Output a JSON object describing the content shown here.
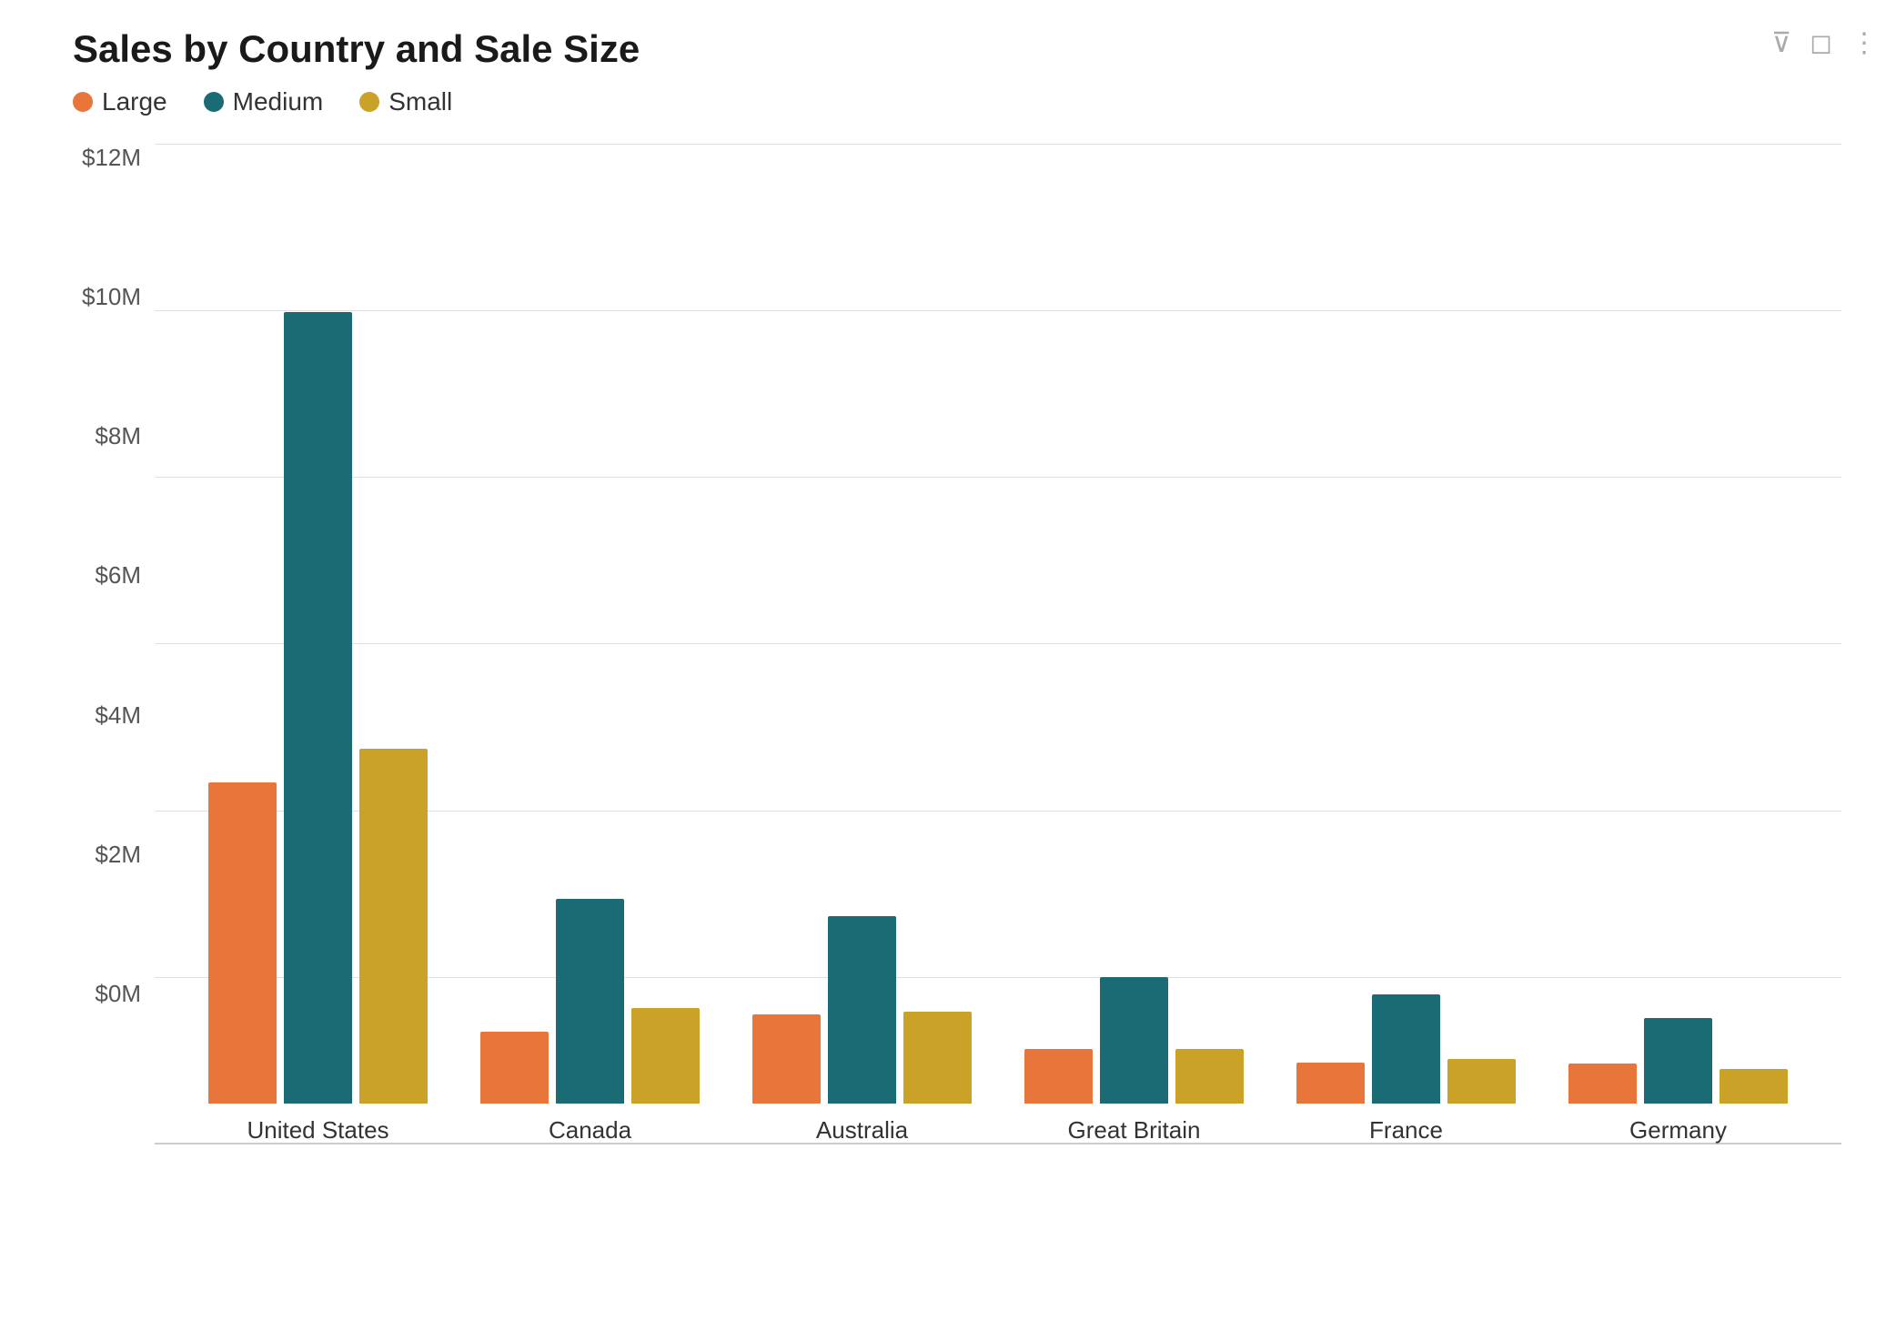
{
  "chart": {
    "title": "Sales by Country and Sale Size",
    "filter_icon": "⊽",
    "icons": [
      "⊽",
      "⬜",
      "⬜"
    ]
  },
  "legend": {
    "items": [
      {
        "label": "Large",
        "color": "#E8763A"
      },
      {
        "label": "Medium",
        "color": "#1A6B73"
      },
      {
        "label": "Small",
        "color": "#C9A227"
      }
    ]
  },
  "y_axis": {
    "labels": [
      "$0M",
      "$2M",
      "$4M",
      "$6M",
      "$8M",
      "$10M",
      "$12M"
    ]
  },
  "bar_groups": [
    {
      "country": "United States",
      "large": 4700000,
      "medium": 11600000,
      "small": 5200000
    },
    {
      "country": "Canada",
      "large": 1050000,
      "medium": 3000000,
      "small": 1400000
    },
    {
      "country": "Australia",
      "large": 1300000,
      "medium": 2750000,
      "small": 1350000
    },
    {
      "country": "Great Britain",
      "large": 800000,
      "medium": 1850000,
      "small": 800000
    },
    {
      "country": "France",
      "large": 600000,
      "medium": 1600000,
      "small": 650000
    },
    {
      "country": "Germany",
      "large": 580000,
      "medium": 1250000,
      "small": 500000
    }
  ],
  "colors": {
    "large": "#E8763A",
    "medium": "#1A6B73",
    "small": "#C9A227"
  }
}
